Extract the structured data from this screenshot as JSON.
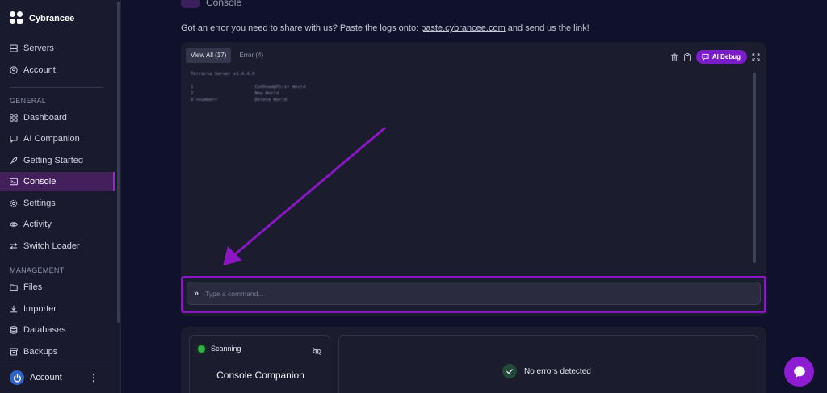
{
  "brand": {
    "name": "Cybrancee"
  },
  "sidebar": {
    "top_items": [
      {
        "label": "Servers",
        "icon": "server-icon"
      },
      {
        "label": "Account",
        "icon": "user-circle-icon"
      }
    ],
    "general_label": "GENERAL",
    "general_items": [
      {
        "label": "Dashboard",
        "icon": "grid-icon"
      },
      {
        "label": "AI Companion",
        "icon": "chat-icon"
      },
      {
        "label": "Getting Started",
        "icon": "rocket-icon"
      },
      {
        "label": "Console",
        "icon": "terminal-icon",
        "active": true
      },
      {
        "label": "Settings",
        "icon": "gear-icon"
      },
      {
        "label": "Activity",
        "icon": "eye-icon"
      },
      {
        "label": "Switch Loader",
        "icon": "swap-icon"
      }
    ],
    "management_label": "MANAGEMENT",
    "management_items": [
      {
        "label": "Files",
        "icon": "folder-icon"
      },
      {
        "label": "Importer",
        "icon": "download-icon"
      },
      {
        "label": "Databases",
        "icon": "database-icon"
      },
      {
        "label": "Backups",
        "icon": "archive-icon"
      }
    ],
    "account_bottom": {
      "label": "Account"
    }
  },
  "main": {
    "page_title": "Console",
    "share_text_before": "Got an error you need to share with us? Paste the logs onto: ",
    "share_link": "paste.cybrancee.com",
    "share_text_after": " and send us the link!",
    "tabs": [
      {
        "label": "View All (17)",
        "active": true
      },
      {
        "label": "Error (4)",
        "active": false
      }
    ],
    "ai_debug_label": "AI Debug",
    "log_lines": [
      "Terraria Server v1.4.4.9",
      "1              \t\tCybRoad@First World",
      "2              \t\tNew World",
      "d <number>    \t\tDelete World"
    ],
    "command_placeholder": "Type a command...",
    "companion": {
      "status": "Scanning",
      "title": "Console Companion"
    },
    "errors_status": "No errors detected"
  },
  "colors": {
    "accent": "#8a16c4",
    "active_nav_bg": "#43205c",
    "background": "#10112a",
    "sidebar_bg": "#191a2e",
    "status_green": "#2fae4a"
  }
}
